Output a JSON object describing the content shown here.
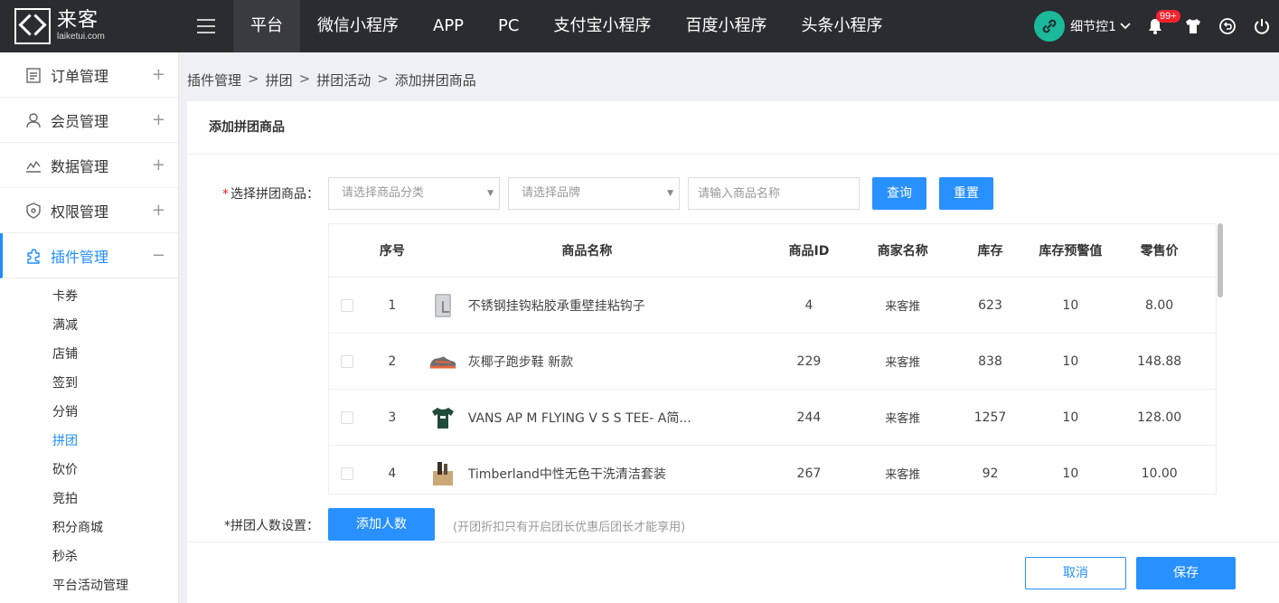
{
  "topbar": {
    "logo_title": "来客",
    "logo_sub": "laiketui.com",
    "nav": [
      "平台",
      "微信小程序",
      "APP",
      "PC",
      "支付宝小程序",
      "百度小程序",
      "头条小程序"
    ],
    "active_nav": "平台",
    "user_name": "细节控1",
    "notification_count": "99+",
    "icons": [
      "menu-icon",
      "link-icon",
      "bell-icon",
      "shirt-icon",
      "back-icon",
      "power-icon"
    ]
  },
  "sidebar": {
    "items": [
      {
        "label": "订单管理",
        "icon": "order-icon",
        "toggle": "+"
      },
      {
        "label": "会员管理",
        "icon": "member-icon",
        "toggle": "+"
      },
      {
        "label": "数据管理",
        "icon": "chart-icon",
        "toggle": "+"
      },
      {
        "label": "权限管理",
        "icon": "shield-icon",
        "toggle": "+"
      },
      {
        "label": "插件管理",
        "icon": "puzzle-icon",
        "toggle": "−"
      }
    ],
    "sub_items": [
      "卡券",
      "满减",
      "店铺",
      "签到",
      "分销",
      "拼团",
      "砍价",
      "竞拍",
      "积分商城",
      "秒杀",
      "平台活动管理"
    ],
    "active_sub": "拼团"
  },
  "breadcrumb": [
    "插件管理",
    "拼团",
    "拼团活动",
    "添加拼团商品"
  ],
  "breadcrumb_sep": ">",
  "page": {
    "title": "添加拼团商品",
    "select_label": "选择拼团商品：",
    "required_mark": "*",
    "category_placeholder": "请选择商品分类",
    "brand_placeholder": "请选择品牌",
    "name_placeholder": "请输入商品名称",
    "query_btn": "查询",
    "reset_btn": "重置",
    "group_label": "*拼团人数设置：",
    "add_people_btn": "添加人数",
    "hint": "(开团折扣只有开启团长优惠后团长才能享用)",
    "cancel_btn": "取消",
    "save_btn": "保存"
  },
  "table": {
    "headers": {
      "no": "序号",
      "name": "商品名称",
      "id": "商品ID",
      "shop": "商家名称",
      "stock": "库存",
      "warn": "库存预警值",
      "price": "零售价"
    },
    "rows": [
      {
        "no": "1",
        "name": "不锈钢挂钩粘胶承重壁挂粘钩子",
        "id": "4",
        "shop": "来客推",
        "stock": "623",
        "warn": "10",
        "price": "8.00",
        "thumb": "hook"
      },
      {
        "no": "2",
        "name": "灰椰子跑步鞋 新款",
        "id": "229",
        "shop": "来客推",
        "stock": "838",
        "warn": "10",
        "price": "148.88",
        "thumb": "shoe"
      },
      {
        "no": "3",
        "name": "VANS AP M FLYING V S S TEE- A简...",
        "id": "244",
        "shop": "来客推",
        "stock": "1257",
        "warn": "10",
        "price": "128.00",
        "thumb": "tshirt"
      },
      {
        "no": "4",
        "name": "Timberland中性无色干洗清洁套装",
        "id": "267",
        "shop": "来客推",
        "stock": "92",
        "warn": "10",
        "price": "10.00",
        "thumb": "kit"
      }
    ]
  }
}
